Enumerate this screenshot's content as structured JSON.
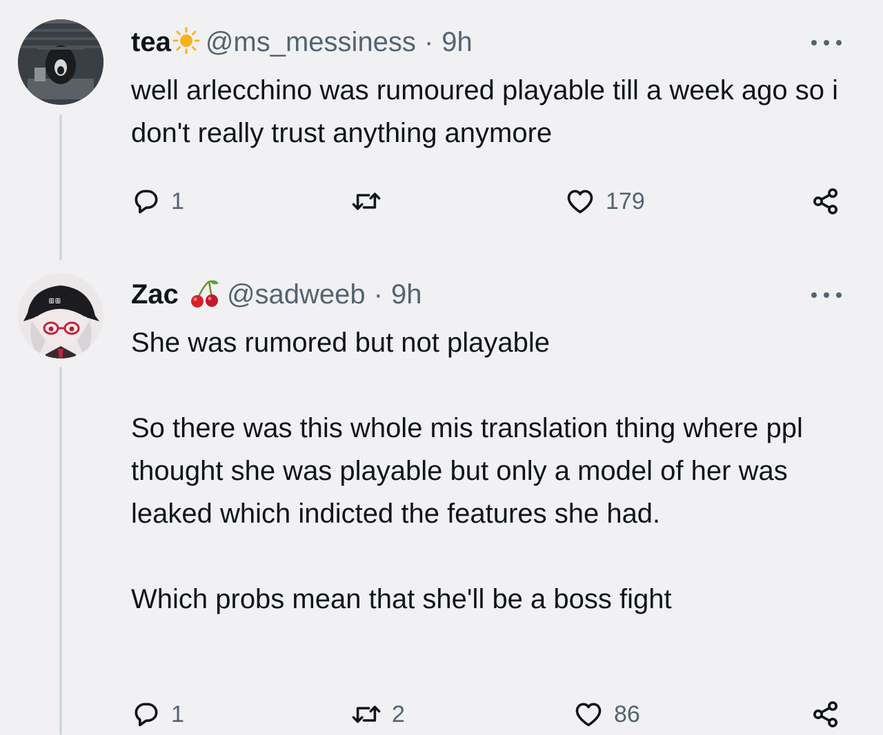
{
  "tweets": [
    {
      "display_name": "tea",
      "name_emoji": "sun-emoji",
      "handle": "@ms_messiness",
      "separator": "·",
      "time": "9h",
      "text_paragraphs": [
        "well arlecchino was rumoured playable till a week ago so i don't really trust anything anymore"
      ],
      "replies": "1",
      "retweets": "",
      "likes": "179"
    },
    {
      "display_name": "Zac",
      "name_emoji": "cherry-emoji",
      "handle": "@sadweeb",
      "separator": "·",
      "time": "9h",
      "text_paragraphs": [
        "She was rumored but not playable",
        "So there was this whole mis translation thing where ppl thought she was playable but only a model of her was leaked which indicted the features she had.",
        "Which probs mean that she'll be a boss fight"
      ],
      "replies": "1",
      "retweets": "2",
      "likes": "86"
    }
  ],
  "icons": {
    "reply": "speech-bubble-icon",
    "retweet": "retweet-arrows-icon",
    "like": "heart-icon",
    "share": "share-nodes-icon",
    "more": "three-dots-icon"
  },
  "colors": {
    "background": "#f1f1f3",
    "text_primary": "#0f1419",
    "text_secondary": "#536471",
    "thread_line": "#cfd9de"
  }
}
